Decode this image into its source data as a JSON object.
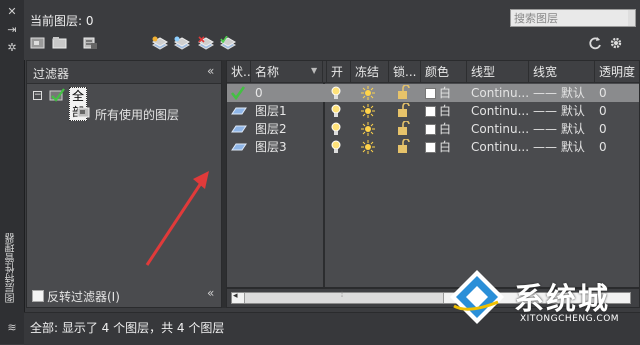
{
  "vstrip": {
    "title": "图层特性管理器"
  },
  "header": {
    "current_layer_label": "当前图层: 0",
    "search_placeholder": "搜索图层"
  },
  "filters": {
    "header": "过滤器",
    "root": "全部",
    "child": "所有使用的图层",
    "invert": "反转过滤器(I)"
  },
  "columns": [
    "状...",
    "名称",
    "开",
    "冻结",
    "锁...",
    "颜色",
    "线型",
    "线宽",
    "透明度"
  ],
  "rows": [
    {
      "status": "current",
      "name": "0",
      "color": "白",
      "linetype": "Continu...",
      "lineweight": "—— 默认",
      "transparency": "0"
    },
    {
      "status": "layer",
      "name": "图层1",
      "color": "白",
      "linetype": "Continu...",
      "lineweight": "—— 默认",
      "transparency": "0"
    },
    {
      "status": "layer",
      "name": "图层2",
      "color": "白",
      "linetype": "Continu...",
      "lineweight": "—— 默认",
      "transparency": "0"
    },
    {
      "status": "layer",
      "name": "图层3",
      "color": "白",
      "linetype": "Continu...",
      "lineweight": "—— 默认",
      "transparency": "0"
    }
  ],
  "status_text": "全部: 显示了 4 个图层，共 4 个图层",
  "watermark": {
    "text": "系统城",
    "sub": "XITONGCHENG.COM"
  },
  "colors": {
    "accent_arrow": "#e03a3a",
    "sel_row": "#8a8b8d",
    "panel": "#4a4b4e"
  }
}
